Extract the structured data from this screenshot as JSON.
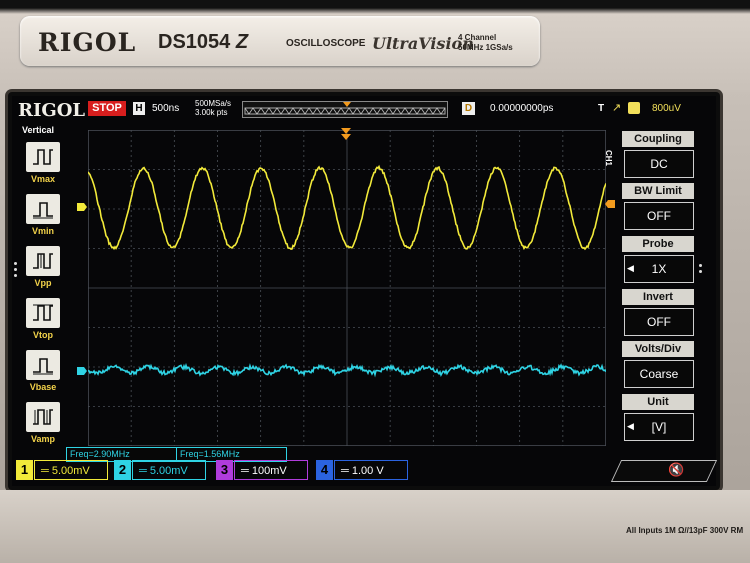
{
  "device": {
    "brand": "RIGOL",
    "model": "DS1054",
    "model_suffix": "Z",
    "category": "OSCILLOSCOPE",
    "series": "UltraVision",
    "spec_line1": "4 Channel",
    "spec_line2": "50MHz  1GSa/s",
    "inputs_label": "All Inputs 1M Ω//13pF 300V RM"
  },
  "status_bar": {
    "logo": "RIGOL",
    "run_state": "STOP",
    "h_label": "H",
    "timebase": "500ns",
    "sample_rate": "500MSa/s",
    "memory_depth": "3.00k pts",
    "d_label": "D",
    "delay": "0.00000000ps",
    "t_label": "T",
    "trigger_level": "800uV"
  },
  "measure_panel": {
    "title": "Vertical",
    "items": [
      {
        "label": "Vmax",
        "icon": "vmax-icon"
      },
      {
        "label": "Vmin",
        "icon": "vmin-icon"
      },
      {
        "label": "Vpp",
        "icon": "vpp-icon"
      },
      {
        "label": "Vtop",
        "icon": "vtop-icon"
      },
      {
        "label": "Vbase",
        "icon": "vbase-icon"
      },
      {
        "label": "Vamp",
        "icon": "vamp-icon"
      }
    ]
  },
  "channel_menu": {
    "channel_tag": "CH1",
    "items": [
      {
        "label": "Coupling",
        "value": "DC"
      },
      {
        "label": "BW Limit",
        "value": "OFF"
      },
      {
        "label": "Probe",
        "value": "1X"
      },
      {
        "label": "Invert",
        "value": "OFF"
      },
      {
        "label": "Volts/Div",
        "value": "Coarse"
      },
      {
        "label": "Unit",
        "value": "[V]"
      }
    ]
  },
  "readouts": {
    "freq1": "Freq=2.90MHz",
    "freq2": "Freq=1.56MHz"
  },
  "channels": [
    {
      "num": "1",
      "scale": "5.00mV",
      "color": "#f2ea3a"
    },
    {
      "num": "2",
      "scale": "5.00mV",
      "color": "#2fd3e4"
    },
    {
      "num": "3",
      "scale": "100mV",
      "color": "#b03cdc"
    },
    {
      "num": "4",
      "scale": "1.00 V",
      "color": "#2b63e0"
    }
  ],
  "colors": {
    "ch1": "#f2ea3a",
    "ch2": "#2fd3e4",
    "stop": "#d71e1e",
    "grid": "#4a4f57"
  }
}
